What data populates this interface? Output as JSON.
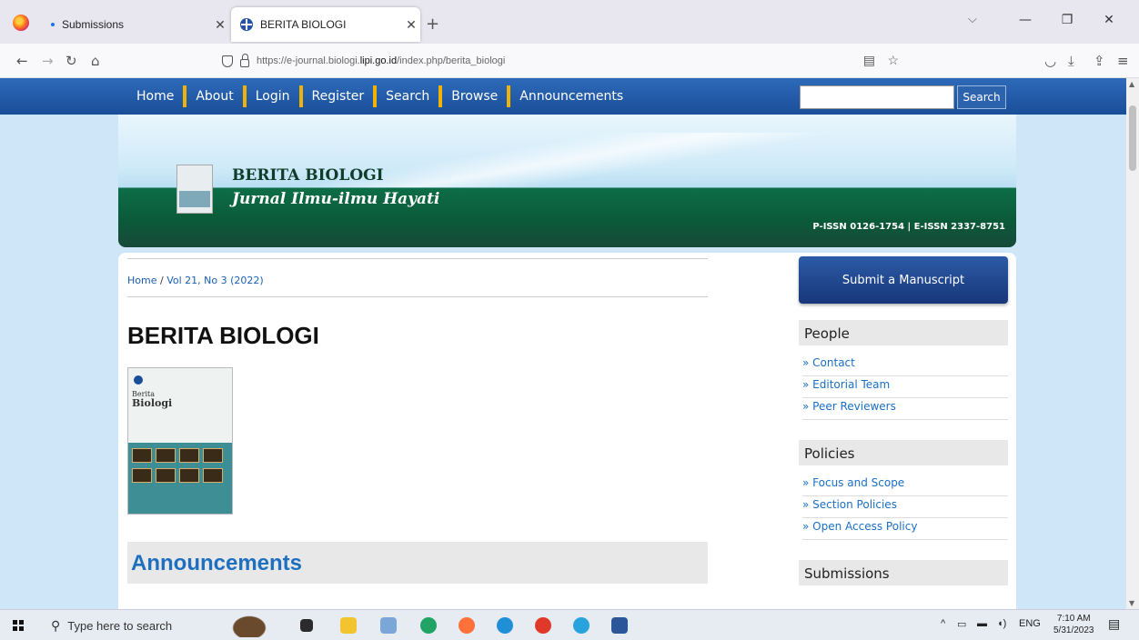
{
  "browser": {
    "tabs": [
      {
        "title": "Submissions"
      },
      {
        "title": "BERITA BIOLOGI"
      }
    ],
    "new_tab": "+",
    "tab_list": "⌵",
    "url": {
      "prefix": "https://e-journal.biologi.",
      "host": "lipi.go.id",
      "path": "/index.php/berita_biologi"
    }
  },
  "site": {
    "nav": [
      "Home",
      "About",
      "Login",
      "Register",
      "Search",
      "Browse",
      "Announcements"
    ],
    "search_button": "Search",
    "search_placeholder": "",
    "banner": {
      "name": "BERITA BIOLOGI",
      "tagline": "Jurnal Ilmu-ilmu Hayati",
      "issn": "P-ISSN 0126-1754 | E-ISSN 2337-8751"
    },
    "breadcrumb": {
      "home": "Home",
      "separator": " / ",
      "current": "Vol 21, No 3 (2022)"
    },
    "title": "BERITA BIOLOGI",
    "cover": {
      "line1": "Berita",
      "line2": "Biologi"
    },
    "announcements_heading": "Announcements"
  },
  "sidebar": {
    "submit_button": "Submit a Manuscript",
    "blocks": [
      {
        "heading": "People",
        "links": [
          "» Contact",
          "» Editorial Team",
          "» Peer Reviewers"
        ]
      },
      {
        "heading": "Policies",
        "links": [
          "» Focus and Scope",
          "» Section Policies",
          "» Open Access Policy"
        ]
      },
      {
        "heading": "Submissions",
        "links": []
      }
    ]
  },
  "taskbar": {
    "search_placeholder": "Type here to search",
    "language": "ENG",
    "time": "7:10 AM",
    "date": "5/31/2023"
  },
  "colors": {
    "nav_bar": "#1a4e99",
    "nav_separator": "#f0b400",
    "link": "#1a6fc4",
    "banner_green": "#0d6e46",
    "page_bg": "#cfe6f8"
  }
}
